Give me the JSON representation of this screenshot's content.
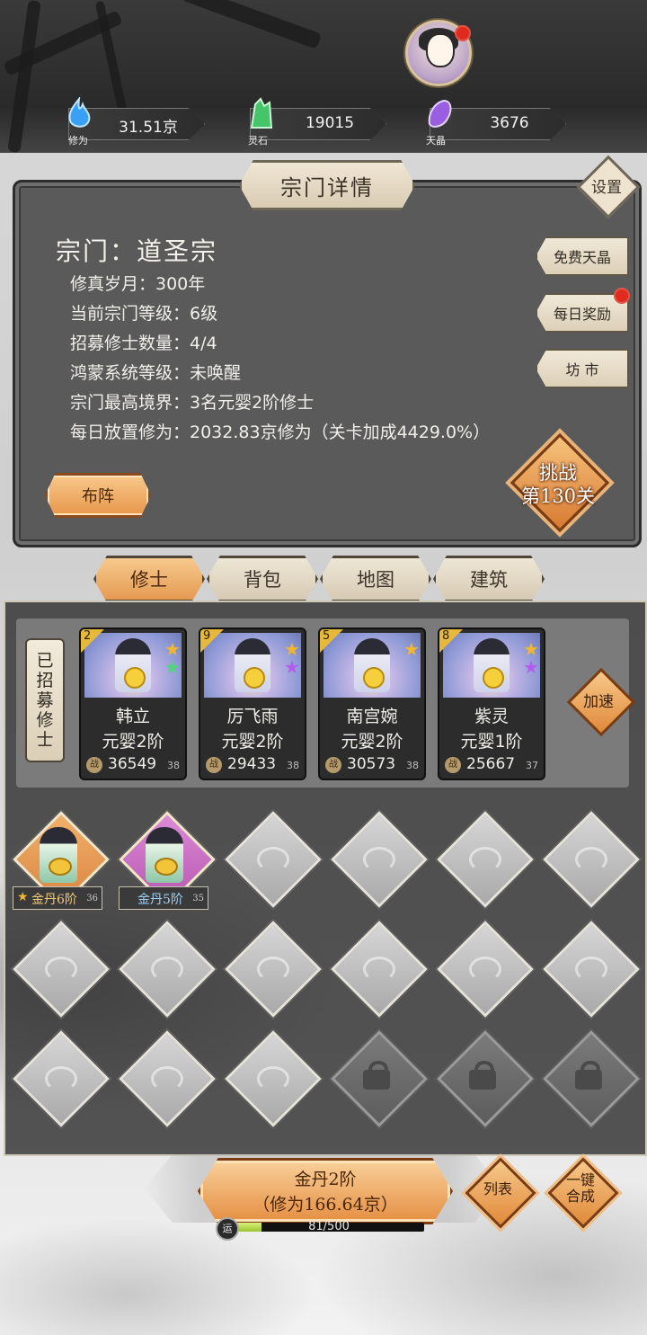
{
  "resources": [
    {
      "name": "修为",
      "value": "31.51京",
      "icon": "blue-flame-icon",
      "color": "#4aa8f0"
    },
    {
      "name": "灵石",
      "value": "19015",
      "icon": "green-crystal-icon",
      "color": "#49c46a"
    },
    {
      "name": "天晶",
      "value": "3676",
      "icon": "purple-crystal-icon",
      "color": "#9a5fe0"
    }
  ],
  "panel": {
    "title": "宗门详情",
    "settings": "设置",
    "sect_name": "宗门：道圣宗",
    "info": [
      "修真岁月：300年",
      "当前宗门等级：6级",
      "招募修士数量：4/4",
      "鸿蒙系统等级：未唤醒",
      "宗门最高境界：3名元婴2阶修士",
      "每日放置修为：2032.83京修为（关卡加成4429.0%）"
    ],
    "side_buttons": [
      "免费天晶",
      "每日奖励",
      "坊 市"
    ],
    "formation": "布阵",
    "challenge": [
      "挑战",
      "第130关"
    ]
  },
  "tabs": [
    "修士",
    "背包",
    "地图",
    "建筑"
  ],
  "recruited_label": [
    "已",
    "招",
    "募",
    "修",
    "士"
  ],
  "speed_up": "加速",
  "cards": [
    {
      "level": "2",
      "name": "韩立",
      "realm": "元婴2阶",
      "power": "36549",
      "sub": "38",
      "stars": [
        "#f3b62c",
        "#4fd67a"
      ]
    },
    {
      "level": "9",
      "name": "厉飞雨",
      "realm": "元婴2阶",
      "power": "29433",
      "sub": "38",
      "stars": [
        "#f3b62c",
        "#b35cf0"
      ]
    },
    {
      "level": "5",
      "name": "南宫婉",
      "realm": "元婴2阶",
      "power": "30573",
      "sub": "38",
      "stars": [
        "#f3b62c"
      ]
    },
    {
      "level": "8",
      "name": "紫灵",
      "realm": "元婴1阶",
      "power": "25667",
      "sub": "37",
      "stars": [
        "#f3b62c",
        "#b35cf0"
      ]
    }
  ],
  "slots": [
    {
      "label": "金丹6阶",
      "sub": "36",
      "star": "★",
      "color": "#e49a4c"
    },
    {
      "label": "金丹5阶",
      "sub": "35",
      "star": "",
      "color": "#c864c8"
    }
  ],
  "bottom": {
    "main_line1": "金丹2阶",
    "main_line2": "（修为166.64京）",
    "list": "列表",
    "merge": [
      "一键",
      "合成"
    ],
    "luck_icon": "运",
    "progress_text": "81/500",
    "progress_fraction": 0.162
  }
}
